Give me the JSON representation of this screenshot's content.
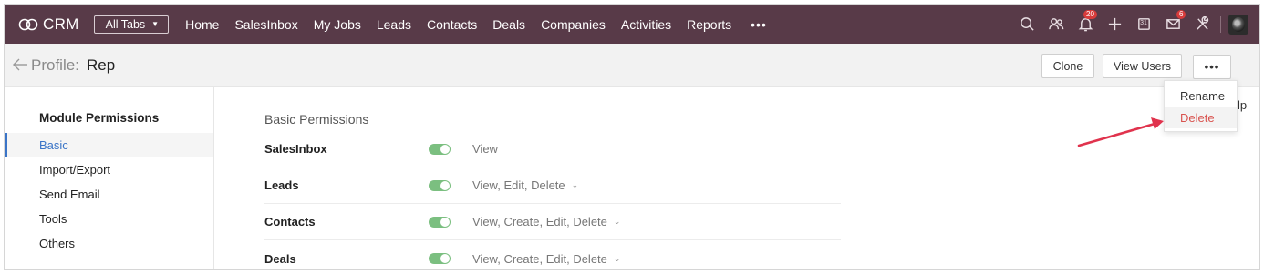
{
  "topnav": {
    "logo_text": "CRM",
    "all_tabs_label": "All Tabs",
    "links": [
      "Home",
      "SalesInbox",
      "My Jobs",
      "Leads",
      "Contacts",
      "Deals",
      "Companies",
      "Activities",
      "Reports"
    ],
    "more_label": "•••",
    "notifications_count": "20",
    "mail_count": "6",
    "calendar_day": "31",
    "icons": [
      "search-icon",
      "contacts-icon",
      "bell-icon",
      "plus-icon",
      "calendar-icon",
      "mail-icon",
      "tools-icon",
      "avatar"
    ]
  },
  "subheader": {
    "profile_label": "Profile:",
    "profile_name": "Rep",
    "clone_label": "Clone",
    "view_users_label": "View Users",
    "more_label": "•••"
  },
  "sidebar": {
    "title": "Module Permissions",
    "items": [
      "Basic",
      "Import/Export",
      "Send Email",
      "Tools",
      "Others"
    ],
    "active_item": "Basic"
  },
  "main": {
    "section_title": "Basic Permissions",
    "rows": [
      {
        "module": "SalesInbox",
        "enabled": true,
        "permissions": "View",
        "has_dropdown": false
      },
      {
        "module": "Leads",
        "enabled": true,
        "permissions": "View, Edit, Delete",
        "has_dropdown": true
      },
      {
        "module": "Contacts",
        "enabled": true,
        "permissions": "View, Create, Edit, Delete",
        "has_dropdown": true
      },
      {
        "module": "Deals",
        "enabled": true,
        "permissions": "View, Create, Edit, Delete",
        "has_dropdown": true
      }
    ]
  },
  "menu": {
    "items": [
      "Rename",
      "Delete"
    ],
    "partial_text": "lp"
  },
  "colors": {
    "nav_bg": "#583a48",
    "active_blue": "#3a74c7",
    "toggle_green": "#7bbf80",
    "danger_red": "#d9534f",
    "arrow_red": "#e0334d"
  }
}
